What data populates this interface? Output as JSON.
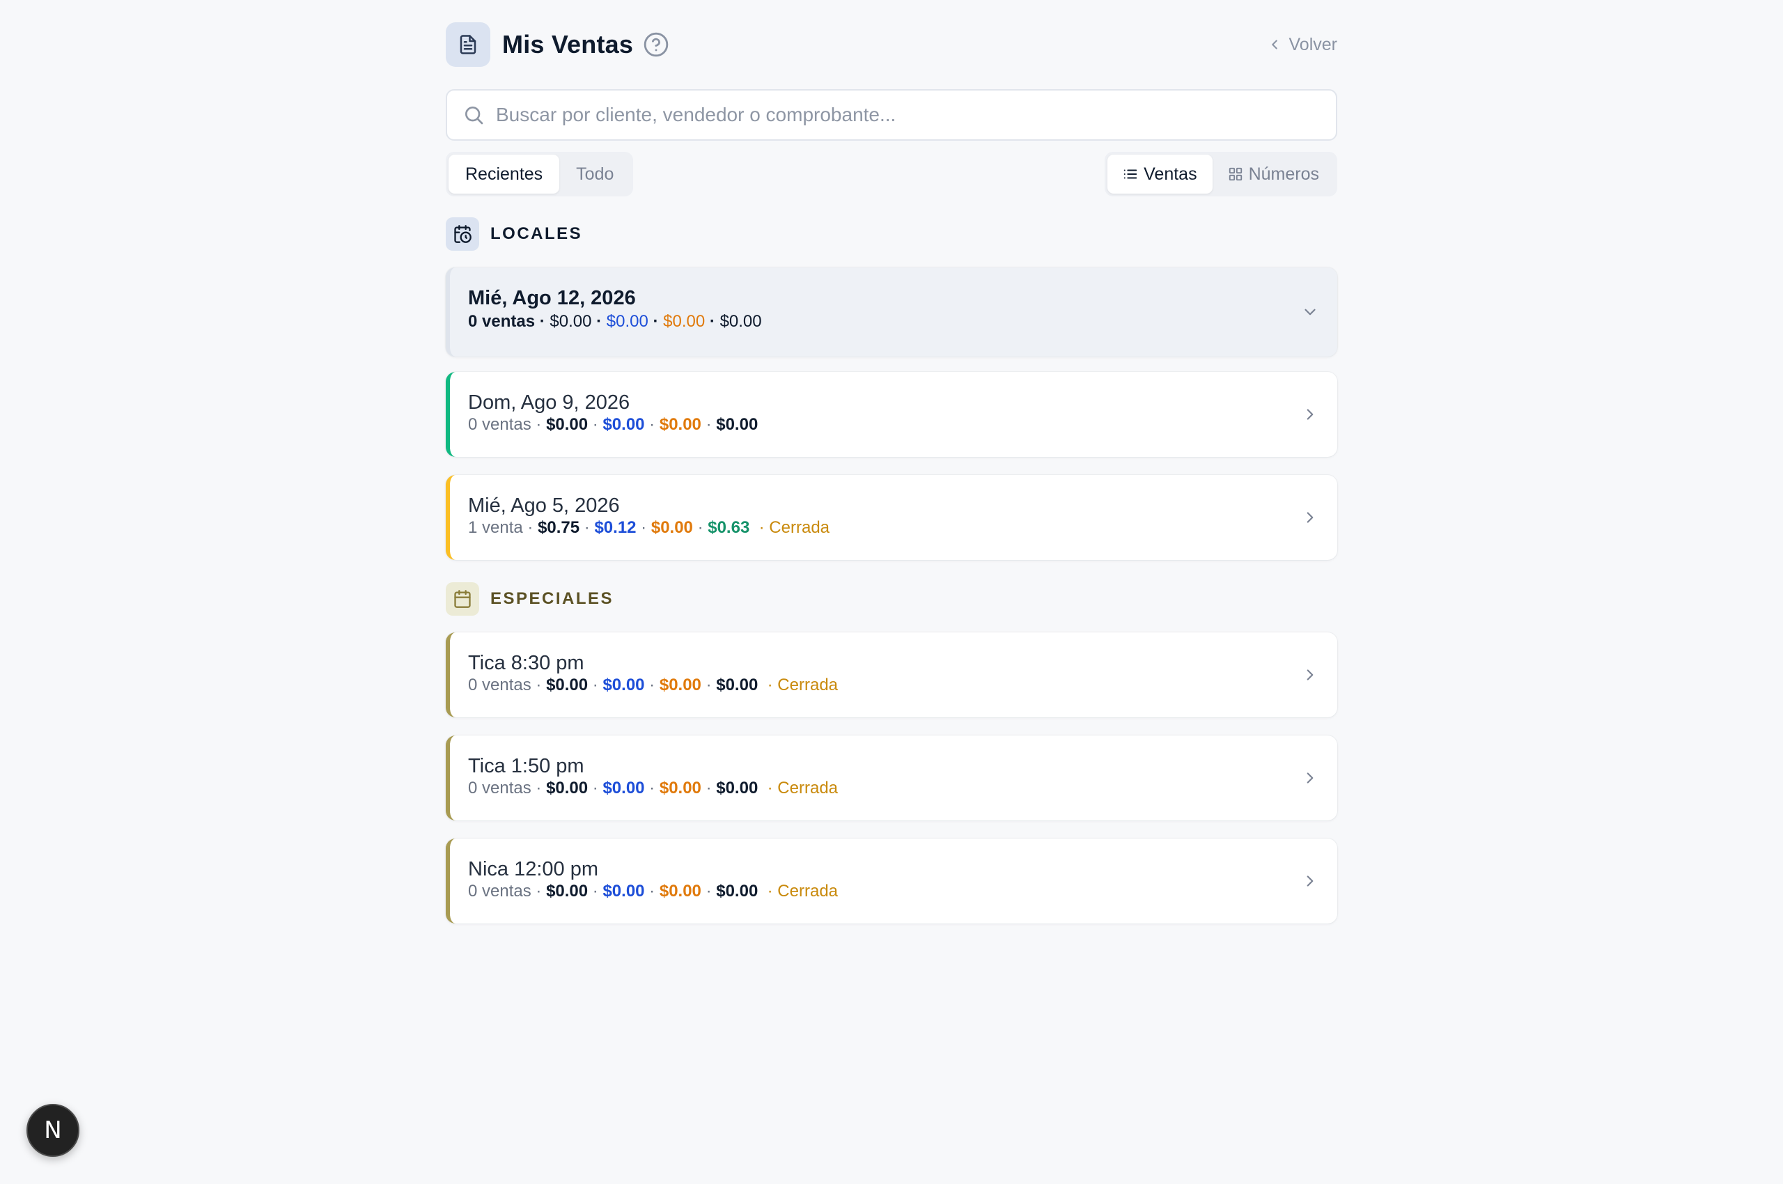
{
  "header": {
    "title": "Mis Ventas",
    "back_label": "Volver"
  },
  "search": {
    "placeholder": "Buscar por cliente, vendedor o comprobante...",
    "value": ""
  },
  "period_toggle": {
    "options": [
      "Recientes",
      "Todo"
    ],
    "selected": "Recientes"
  },
  "view_toggle": {
    "options": [
      {
        "label": "Ventas",
        "icon": "list-icon"
      },
      {
        "label": "Números",
        "icon": "grid-icon"
      }
    ],
    "selected": "Ventas"
  },
  "sections": [
    {
      "label": "LOCALES",
      "icon": "calendar-clock-icon",
      "color": "#0f1b2d",
      "icon_bg": "#dbe3f1",
      "items": [
        {
          "title": "Mié, Ago 12, 2026",
          "count": "0 ventas",
          "total": "$0.00",
          "blue": "$0.00",
          "orange": "$0.00",
          "last": "$0.00",
          "status": "",
          "accent": "#dfe4ec",
          "expanded": true
        },
        {
          "title": "Dom, Ago 9, 2026",
          "count": "0 ventas",
          "total": "$0.00",
          "blue": "$0.00",
          "orange": "$0.00",
          "last": "$0.00",
          "status": "",
          "accent": "#10b981",
          "expanded": false
        },
        {
          "title": "Mié, Ago 5, 2026",
          "count": "1 venta",
          "total": "$0.75",
          "blue": "$0.12",
          "orange": "$0.00",
          "last": "$0.63",
          "last_color": "green",
          "status": "· Cerrada",
          "accent": "#fbbf24",
          "expanded": false
        }
      ]
    },
    {
      "label": "ESPECIALES",
      "icon": "calendar-icon",
      "color": "#5b5124",
      "icon_bg": "#ecebd6",
      "items": [
        {
          "title": "Tica 8:30 pm",
          "count": "0 ventas",
          "total": "$0.00",
          "blue": "$0.00",
          "orange": "$0.00",
          "last": "$0.00",
          "status": "· Cerrada",
          "accent": "#a89b52",
          "expanded": false
        },
        {
          "title": "Tica 1:50 pm",
          "count": "0 ventas",
          "total": "$0.00",
          "blue": "$0.00",
          "orange": "$0.00",
          "last": "$0.00",
          "status": "· Cerrada",
          "accent": "#a89b52",
          "expanded": false
        },
        {
          "title": "Nica 12:00 pm",
          "count": "0 ventas",
          "total": "$0.00",
          "blue": "$0.00",
          "orange": "$0.00",
          "last": "$0.00",
          "status": "· Cerrada",
          "accent": "#a89b52",
          "expanded": false
        }
      ]
    }
  ],
  "dev_badge": {
    "label": "N"
  }
}
